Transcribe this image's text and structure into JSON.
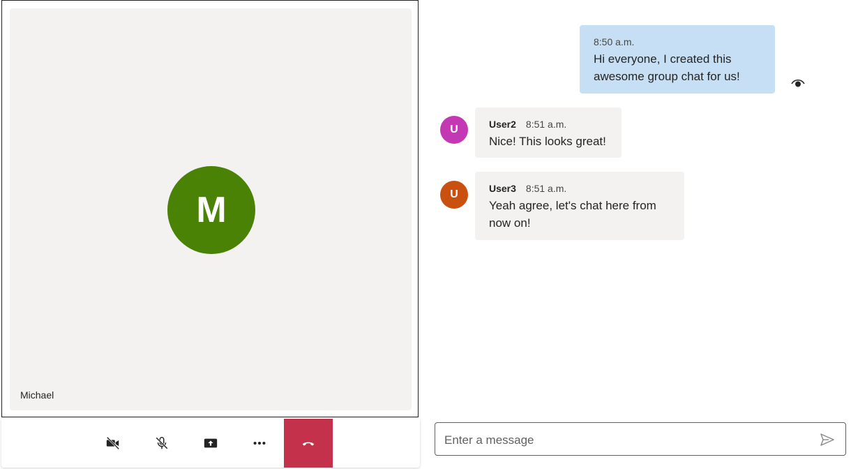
{
  "call": {
    "participant_name": "Michael",
    "participant_initial": "M",
    "participant_avatar_color": "#498205",
    "controls": [
      {
        "name": "camera-off-button",
        "icon": "video-off-icon"
      },
      {
        "name": "mic-off-button",
        "icon": "mic-off-icon"
      },
      {
        "name": "share-screen-button",
        "icon": "share-screen-icon"
      },
      {
        "name": "more-options-button",
        "icon": "more-icon"
      },
      {
        "name": "hang-up-button",
        "icon": "hang-up-icon"
      }
    ],
    "hangup_color": "#c4314b"
  },
  "chat": {
    "messages": [
      {
        "mine": true,
        "time": "8:50 a.m.",
        "text": "Hi everyone, I created this awesome group chat for us!",
        "read": true
      },
      {
        "mine": false,
        "sender": "User2",
        "initial": "U",
        "avatar_color": "#c239b3",
        "time": "8:51 a.m.",
        "text": "Nice! This looks great!"
      },
      {
        "mine": false,
        "sender": "User3",
        "initial": "U",
        "avatar_color": "#ca5010",
        "time": "8:51 a.m.",
        "text": "Yeah agree, let's chat here from now on!"
      }
    ],
    "composer": {
      "placeholder": "Enter a message",
      "value": ""
    }
  }
}
